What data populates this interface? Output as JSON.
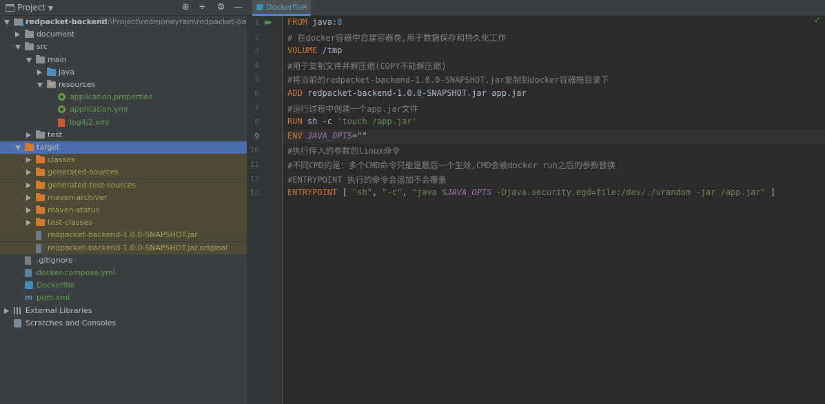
{
  "project_panel": {
    "title": "Project",
    "tools": {
      "locate": "⊕",
      "collapse": "÷",
      "settings": "⚙",
      "hide": "—"
    },
    "tree": [
      {
        "indent": 0,
        "arrow": "down",
        "icon": "module-folder-icon",
        "label": "redpacket-backend",
        "style": "bold",
        "path": "D:\\Project\\redmoneyrain\\redpacket-backend"
      },
      {
        "indent": 1,
        "arrow": "right",
        "icon": "folder-icon",
        "label": "document"
      },
      {
        "indent": 1,
        "arrow": "down",
        "icon": "folder-icon",
        "label": "src"
      },
      {
        "indent": 2,
        "arrow": "down",
        "icon": "folder-icon",
        "label": "main"
      },
      {
        "indent": 3,
        "arrow": "right",
        "icon": "source-folder-icon",
        "label": "java"
      },
      {
        "indent": 3,
        "arrow": "down",
        "icon": "resources-folder-icon",
        "label": "resources"
      },
      {
        "indent": 4,
        "arrow": "",
        "icon": "spring-icon",
        "label": "application.properties",
        "style": "green"
      },
      {
        "indent": 4,
        "arrow": "",
        "icon": "spring-icon",
        "label": "application.yml",
        "style": "green"
      },
      {
        "indent": 4,
        "arrow": "",
        "icon": "xml-icon",
        "label": "log4j2.xml",
        "style": "green"
      },
      {
        "indent": 2,
        "arrow": "right",
        "icon": "folder-icon",
        "label": "test"
      },
      {
        "indent": 1,
        "arrow": "down",
        "icon": "excluded-folder-icon",
        "label": "target",
        "selected": true
      },
      {
        "indent": 2,
        "arrow": "right",
        "icon": "excluded-folder-icon",
        "label": "classes",
        "style": "olive",
        "excluded": true
      },
      {
        "indent": 2,
        "arrow": "right",
        "icon": "excluded-folder-icon",
        "label": "generated-sources",
        "style": "olive",
        "excluded": true
      },
      {
        "indent": 2,
        "arrow": "right",
        "icon": "excluded-folder-icon",
        "label": "generated-test-sources",
        "style": "olive",
        "excluded": true
      },
      {
        "indent": 2,
        "arrow": "right",
        "icon": "excluded-folder-icon",
        "label": "maven-archiver",
        "style": "olive",
        "excluded": true
      },
      {
        "indent": 2,
        "arrow": "right",
        "icon": "excluded-folder-icon",
        "label": "maven-status",
        "style": "olive",
        "excluded": true
      },
      {
        "indent": 2,
        "arrow": "right",
        "icon": "excluded-folder-icon",
        "label": "test-classes",
        "style": "olive",
        "excluded": true
      },
      {
        "indent": 2,
        "arrow": "",
        "icon": "jar-icon",
        "label": "redpacket-backend-1.0.0-SNAPSHOT.jar",
        "style": "olive",
        "excluded": true
      },
      {
        "indent": 2,
        "arrow": "",
        "icon": "unknown-file-icon",
        "label": "redpacket-backend-1.0.0-SNAPSHOT.jar.original",
        "style": "olive",
        "excluded": true
      },
      {
        "indent": 1,
        "arrow": "",
        "icon": "gitignore-icon",
        "label": ".gitignore"
      },
      {
        "indent": 1,
        "arrow": "",
        "icon": "yaml-icon",
        "label": "docker-compose.yml",
        "style": "green"
      },
      {
        "indent": 1,
        "arrow": "",
        "icon": "docker-icon",
        "label": "Dockerfile",
        "style": "green"
      },
      {
        "indent": 1,
        "arrow": "",
        "icon": "maven-icon",
        "label": "pom.xml",
        "style": "green"
      },
      {
        "indent": 0,
        "arrow": "right",
        "icon": "libraries-icon",
        "label": "External Libraries"
      },
      {
        "indent": 0,
        "arrow": "",
        "icon": "scratches-icon",
        "label": "Scratches and Consoles"
      }
    ]
  },
  "editor": {
    "tab": {
      "label": "Dockerfile",
      "close": "×"
    },
    "current_line": 9,
    "run_icon": "▶▶",
    "check": "✓",
    "lines": [
      [
        {
          "t": "FROM ",
          "c": "kw"
        },
        {
          "t": "java:",
          "c": ""
        },
        {
          "t": "8",
          "c": "num"
        }
      ],
      [
        {
          "t": "# 在docker容器中自建容器卷,用于数据保存和持久化工作",
          "c": "cm"
        }
      ],
      [
        {
          "t": "VOLUME ",
          "c": "kw"
        },
        {
          "t": "/tmp",
          "c": ""
        }
      ],
      [
        {
          "t": "#用于复制文件并解压缩(COPY不能解压缩)",
          "c": "cm"
        }
      ],
      [
        {
          "t": "#将当前的redpacket-backend-1.0.0-SNAPSHOT.jar复制到docker容器根目录下",
          "c": "cm"
        }
      ],
      [
        {
          "t": "ADD ",
          "c": "kw"
        },
        {
          "t": "redpacket-backend-1.0.0-SNAPSHOT.jar app.jar",
          "c": ""
        }
      ],
      [
        {
          "t": "#运行过程中创建一个app.jar文件",
          "c": "cm"
        }
      ],
      [
        {
          "t": "RUN ",
          "c": "kw"
        },
        {
          "t": "sh -c ",
          "c": ""
        },
        {
          "t": "'touch /app.jar'",
          "c": "str"
        }
      ],
      [
        {
          "t": "ENV ",
          "c": "kw"
        },
        {
          "t": "JAVA_OPTS",
          "c": "var"
        },
        {
          "t": "=\"\"",
          "c": ""
        }
      ],
      [
        {
          "t": "#执行传入的参数的linux命令",
          "c": "cm"
        }
      ],
      [
        {
          "t": "#不同CMD的是：多个CMD命令只能是最后一个生效,CMD会被docker run之后的参数替换",
          "c": "cm"
        }
      ],
      [
        {
          "t": "#ENTRYPOINT 执行的命令会追加不会覆盖",
          "c": "cm"
        }
      ],
      [
        {
          "t": "ENTRYPOINT ",
          "c": "kw"
        },
        {
          "t": "[ ",
          "c": ""
        },
        {
          "t": "\"sh\"",
          "c": "str"
        },
        {
          "t": ", ",
          "c": ""
        },
        {
          "t": "\"-c\"",
          "c": "str"
        },
        {
          "t": ", ",
          "c": ""
        },
        {
          "t": "\"java $",
          "c": "str"
        },
        {
          "t": "JAVA_OPTS",
          "c": "var"
        },
        {
          "t": " -Djava.security.egd=file:/dev/./urandom -jar /app.jar\"",
          "c": "str"
        },
        {
          "t": " ]",
          "c": ""
        }
      ]
    ]
  }
}
